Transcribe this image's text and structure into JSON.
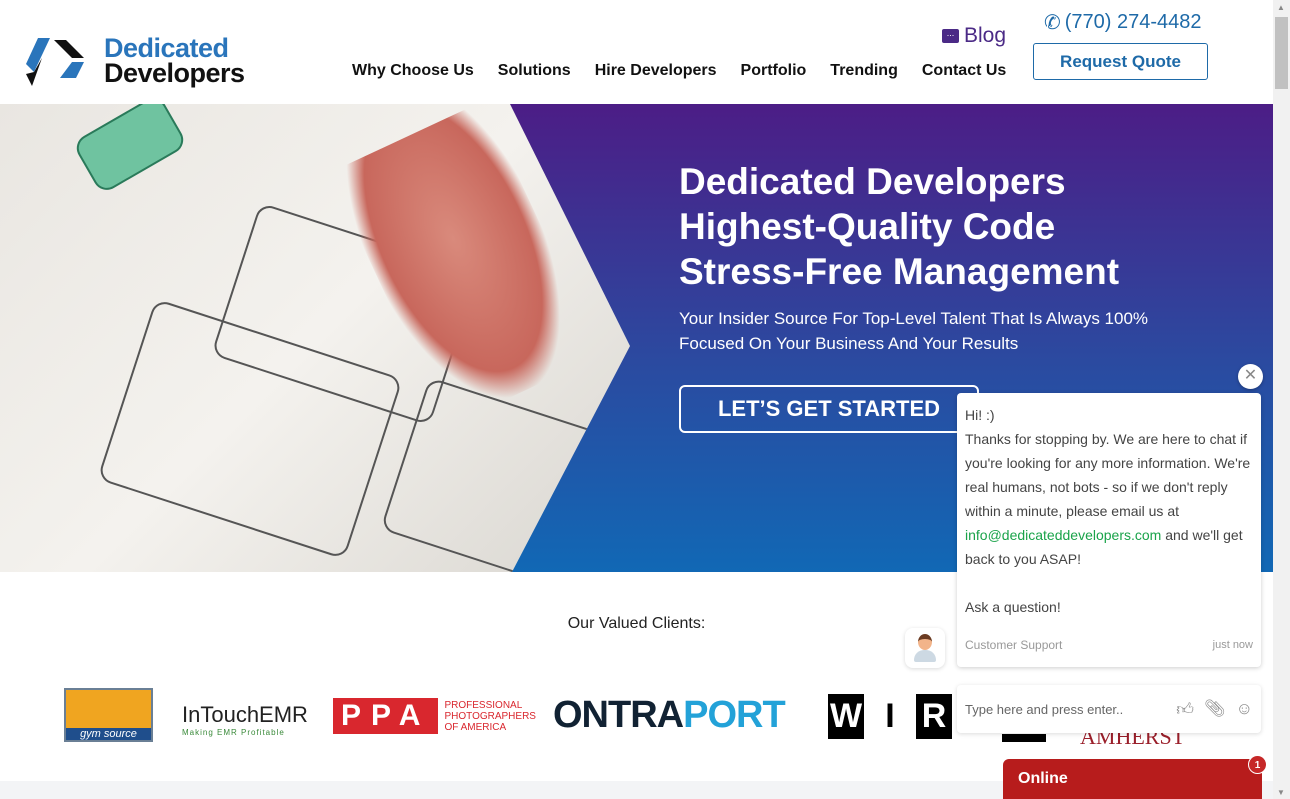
{
  "header": {
    "logo": {
      "line1": "Dedicated",
      "line2": "Developers"
    },
    "nav": [
      "Why Choose Us",
      "Solutions",
      "Hire Developers",
      "Portfolio",
      "Trending",
      "Contact Us"
    ],
    "blog": "Blog",
    "phone": "(770) 274-4482",
    "request_quote": "Request Quote"
  },
  "hero": {
    "title_lines": [
      "Dedicated Developers",
      "Highest-Quality Code",
      "Stress-Free Management"
    ],
    "subtitle": "Your Insider Source For Top-Level Talent That Is Always 100% Focused On Your Business And Your Results",
    "cta": "LET’S GET STARTED"
  },
  "clients": {
    "title": "Our Valued Clients:",
    "logos": {
      "gym": "gym source",
      "intouch": "InTouchEMR",
      "intouch_tag": "Making EMR Profitable",
      "ppa": "PPA",
      "ppa_text": "PROFESSIONAL PHOTOGRAPHERS OF AMERICA",
      "ontra1": "ONTRA",
      "ontra2": "PORT",
      "wired": [
        "W",
        "I",
        "R"
      ],
      "amherst": "AMHERST"
    }
  },
  "chat": {
    "greeting": "Hi! :)",
    "message_before": "Thanks for stopping by. We are here to chat if you're looking for any more information. We're real humans, not bots - so if we don't reply within a minute, please email us at ",
    "email": "info@dedicateddevelopers.com",
    "message_after": " and we'll get back to you ASAP!",
    "prompt": "Ask a question!",
    "sender": "Customer Support",
    "time": "just now",
    "input_placeholder": "Type here and press enter..",
    "status": "Online",
    "unread": "1"
  },
  "colors": {
    "brand_blue": "#2a75bb",
    "blog_purple": "#4b2a86",
    "hero_top": "#4c1d86",
    "hero_bottom": "#1168b5",
    "chat_red": "#b71c1c",
    "link_green": "#1aa34a"
  }
}
